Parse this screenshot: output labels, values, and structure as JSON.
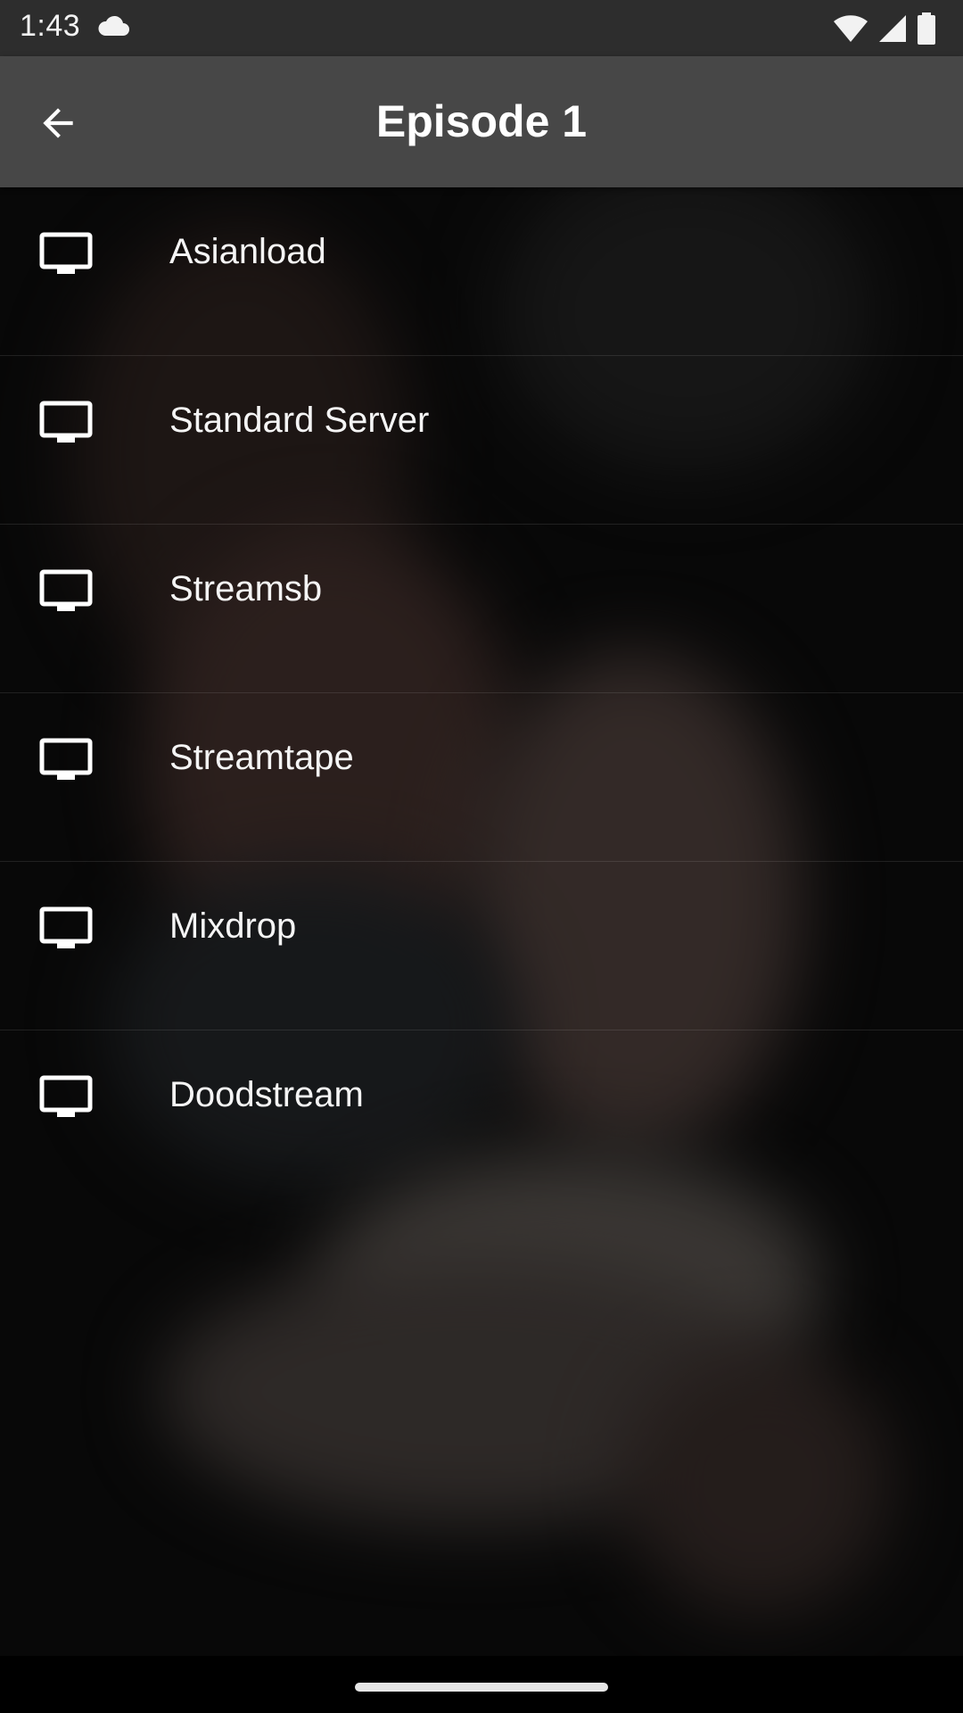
{
  "status_bar": {
    "time": "1:43",
    "icons": [
      "cloud-icon",
      "wifi-icon",
      "signal-icon",
      "battery-icon"
    ]
  },
  "app_bar": {
    "title": "Episode 1",
    "back_icon": "arrow-back-icon"
  },
  "servers": [
    {
      "label": "Asianload",
      "icon": "tv-icon"
    },
    {
      "label": "Standard Server",
      "icon": "tv-icon"
    },
    {
      "label": "Streamsb",
      "icon": "tv-icon"
    },
    {
      "label": "Streamtape",
      "icon": "tv-icon"
    },
    {
      "label": "Mixdrop",
      "icon": "tv-icon"
    },
    {
      "label": "Doodstream",
      "icon": "tv-icon"
    }
  ],
  "colors": {
    "status_bar_bg": "#2d2d2d",
    "app_bar_bg": "#474747",
    "text": "#ffffff",
    "background": "#0c0c0c"
  }
}
